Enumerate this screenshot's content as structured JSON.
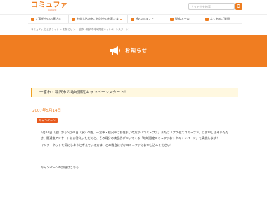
{
  "header": {
    "logo_text": "コミュファ",
    "logo_sub": "from ctc",
    "search_placeholder": "サイト内を検索"
  },
  "nav": {
    "items": [
      {
        "label": "ご契約中のお客さま"
      },
      {
        "label": "お申し込みをご検討中のお客さま"
      },
      {
        "label": "Myコミュファ"
      },
      {
        "label": "Webメール"
      },
      {
        "label": "よくあるご質問"
      }
    ]
  },
  "breadcrumb": "コミュファ光 公式サイト ＞ お知らせ ＞ 一宮市・稲沢市地域限定キャンペーンスタート！",
  "banner": {
    "title": "お知らせ"
  },
  "article": {
    "title": "一宮市・稲沢市の地域限定キャンペーンスタート！",
    "date": "2007年5月14日",
    "tag": "キャンペーン",
    "paragraph1": "5月14日（金）から5月31日（水）の間、一宮市・稲沢市にお住まいの方が「コミュファ」または「アクセスコミュファ」にお申し込みいただき、開通後アンケートにお答えいただくと、その月分の商品券がついてくる「地域限定コミュファおトクキャンペーン」を実施します！",
    "paragraph2": "インターネットを気にしようと考えている方は、この機会にぜひコミュファにお申し込みください！",
    "detail_link": "キャンペーンの詳細はこちら"
  },
  "colors": {
    "accent": "#ee7d1f",
    "banner": "#f07d21",
    "tag": "#e85a1e"
  }
}
